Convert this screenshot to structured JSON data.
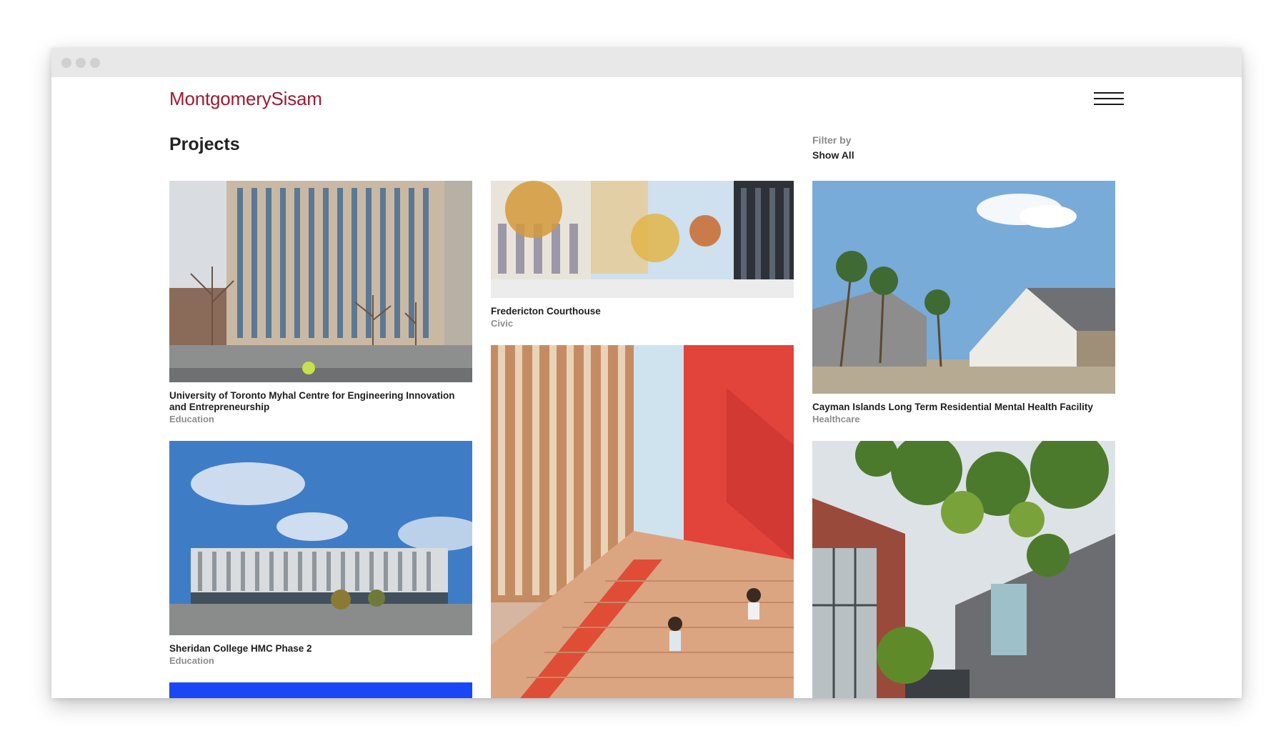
{
  "brand": {
    "logo_text": "MontgomerySisam",
    "logo_color": "#9e1b32"
  },
  "header": {
    "menu_icon": "hamburger-menu-icon"
  },
  "page": {
    "title": "Projects"
  },
  "filter": {
    "label": "Filter by",
    "value": "Show All"
  },
  "projects": [
    {
      "title": "University of Toronto Myhal Centre for Engineering Innovation and Entrepreneurship",
      "category": "Education"
    },
    {
      "title": "Fredericton Courthouse",
      "category": "Civic"
    },
    {
      "title": "Cayman Islands Long Term Residential Mental Health Facility",
      "category": "Healthcare"
    },
    {
      "title": "Sheridan College HMC Phase 2",
      "category": "Education"
    },
    {
      "title": "",
      "category": ""
    },
    {
      "title": "",
      "category": ""
    },
    {
      "title": "",
      "category": ""
    }
  ],
  "colors": {
    "accent_block": "#1a47f5",
    "text": "#222222",
    "muted": "#8d8d8d"
  }
}
